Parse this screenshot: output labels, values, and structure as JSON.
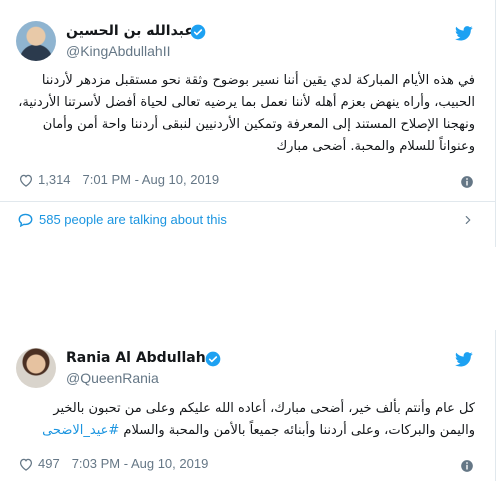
{
  "tweets": [
    {
      "name": "عبدالله بن الحسين",
      "handle": "@KingAbdullahII",
      "text": "في هذه الأيام المباركة لدي يقين أننا نسير بوضوح وثقة نحو مستقبل مزدهر لأردننا الحبيب، وأراه ينهض بعزم أهله لأننا نعمل بما يرضيه تعالى لحياة أفضل لأسرتنا الأردنية، ونهجنا الإصلاح المستند إلى المعرفة وتمكين الأردنيين لنبقى أردننا واحة أمن وأمان وعنواناً للسلام والمحبة. أضحى مبارك",
      "likes": "1,314",
      "timestamp": "7:01 PM - Aug 10, 2019",
      "talking": "585 people are talking about this"
    },
    {
      "name": "Rania Al Abdullah",
      "handle": "@QueenRania",
      "text_main": "كل عام وأنتم بألف خير، أضحى مبارك، أعاده الله عليكم وعلى من تحبون بالخير واليمن والبركات، وعلى أردننا وأبنائه جميعاً بالأمن والمحبة والسلام ",
      "hashtag": "#عيد_الاضحى",
      "likes": "497",
      "timestamp": "7:03 PM - Aug 10, 2019"
    }
  ],
  "colors": {
    "twitter_blue": "#1da1f2",
    "link_blue": "#1b95e0",
    "muted": "#657786"
  },
  "icons": [
    "verified-badge-icon",
    "twitter-bird-icon",
    "heart-icon",
    "info-icon",
    "speech-bubble-icon",
    "chevron-right-icon"
  ]
}
